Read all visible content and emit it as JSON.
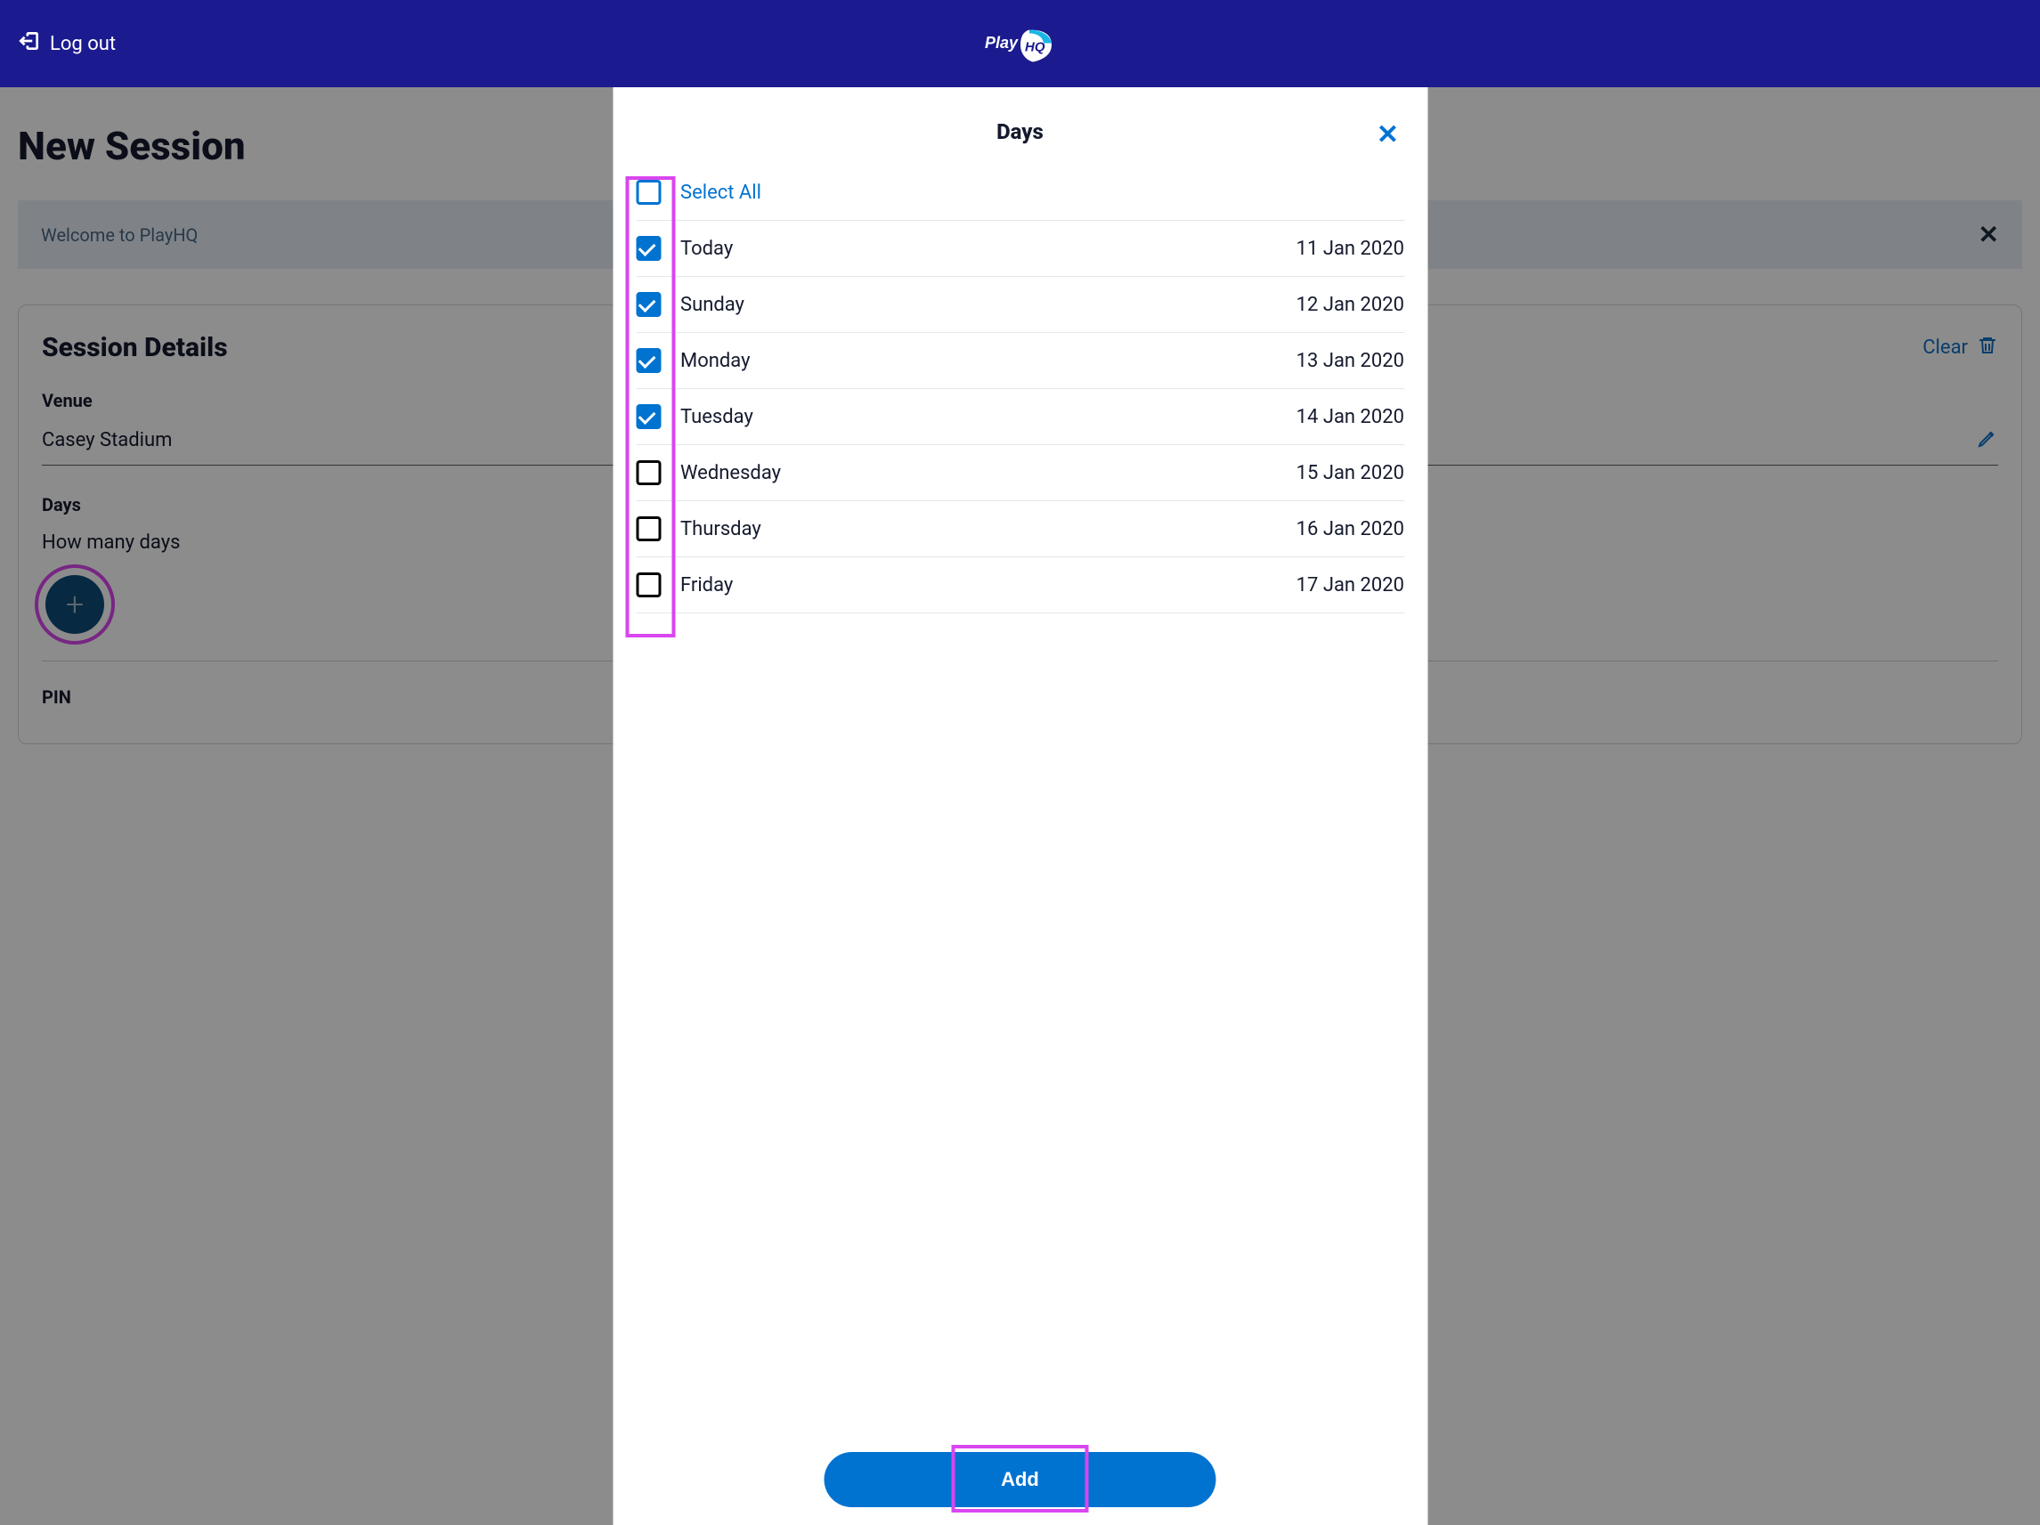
{
  "header": {
    "logout_label": "Log out",
    "logo_text_left": "Play",
    "logo_text_right": "HQ"
  },
  "page": {
    "title": "New Session",
    "banner_text": "Welcome to PlayHQ",
    "session_details_heading": "Session Details",
    "clear_label": "Clear",
    "venue_label": "Venue",
    "venue_value": "Casey Stadium",
    "days_label": "Days",
    "days_question": "How many days",
    "pin_label": "PIN"
  },
  "modal": {
    "title": "Days",
    "select_all_label": "Select All",
    "add_label": "Add",
    "days": [
      {
        "name": "Today",
        "date": "11 Jan 2020",
        "checked": true
      },
      {
        "name": "Sunday",
        "date": "12 Jan 2020",
        "checked": true
      },
      {
        "name": "Monday",
        "date": "13 Jan 2020",
        "checked": true
      },
      {
        "name": "Tuesday",
        "date": "14 Jan 2020",
        "checked": true
      },
      {
        "name": "Wednesday",
        "date": "15 Jan 2020",
        "checked": false
      },
      {
        "name": "Thursday",
        "date": "16 Jan 2020",
        "checked": false
      },
      {
        "name": "Friday",
        "date": "17 Jan 2020",
        "checked": false
      }
    ]
  }
}
